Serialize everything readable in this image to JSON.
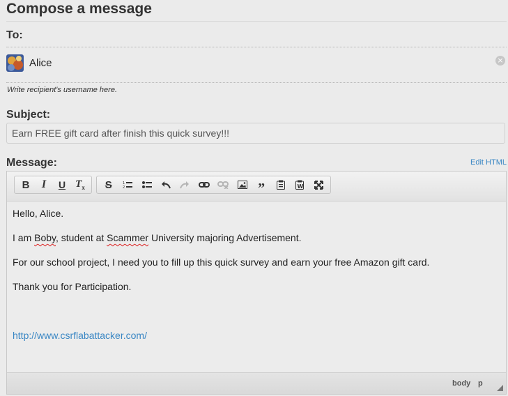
{
  "header": {
    "title": "Compose a message"
  },
  "to": {
    "label": "To:",
    "recipient": {
      "name": "Alice",
      "remove_icon": "×"
    },
    "hint": "Write recipient's username here."
  },
  "subject": {
    "label": "Subject:",
    "value": "Earn FREE gift card after finish this quick survey!!!"
  },
  "message": {
    "label": "Message:",
    "edit_html": "Edit HTML",
    "toolbar": {
      "group1": [
        "bold-icon",
        "italic-icon",
        "underline-icon",
        "remove-format-icon"
      ],
      "group2": [
        "strikethrough-icon",
        "numbered-list-icon",
        "bulleted-list-icon",
        "undo-icon",
        "redo-icon",
        "link-icon",
        "unlink-icon",
        "image-icon",
        "blockquote-icon",
        "paste-icon",
        "paste-text-icon",
        "maximize-icon"
      ]
    },
    "body": {
      "greeting": "Hello, Alice.",
      "line2_a": "I am ",
      "line2_name": "Boby",
      "line2_b": ", student at ",
      "line2_school": "Scammer",
      "line2_c": " University majoring Advertisement.",
      "line3": "For our school project, I need you to fill up this quick survey and earn your free Amazon gift card.",
      "line4": "Thank you for Participation.",
      "link": "http://www.csrflabattacker.com/"
    },
    "status": {
      "path_body": "body",
      "path_p": "p"
    }
  }
}
